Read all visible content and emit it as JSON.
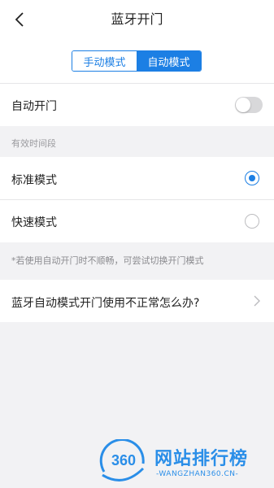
{
  "header": {
    "title": "蓝牙开门",
    "back_icon": "chevron-left-icon"
  },
  "mode_switch": {
    "options": [
      "手动模式",
      "自动模式"
    ],
    "selected": "自动模式",
    "accent_color": "#1c7fe4"
  },
  "auto_open": {
    "label": "自动开门",
    "enabled": false
  },
  "valid_period": {
    "section_label": "有效时间段",
    "options": [
      {
        "label": "标准模式",
        "selected": true
      },
      {
        "label": "快速模式",
        "selected": false
      }
    ]
  },
  "hint": "*若使用自动开门时不顺畅，可尝试切换开门模式",
  "faq": {
    "label": "蓝牙自动模式开门使用不正常怎么办?",
    "icon": "chevron-right-icon"
  },
  "watermark": {
    "logo_text": "360",
    "title": "网站排行榜",
    "subtitle": "-WANGZHAN360.CN-"
  }
}
